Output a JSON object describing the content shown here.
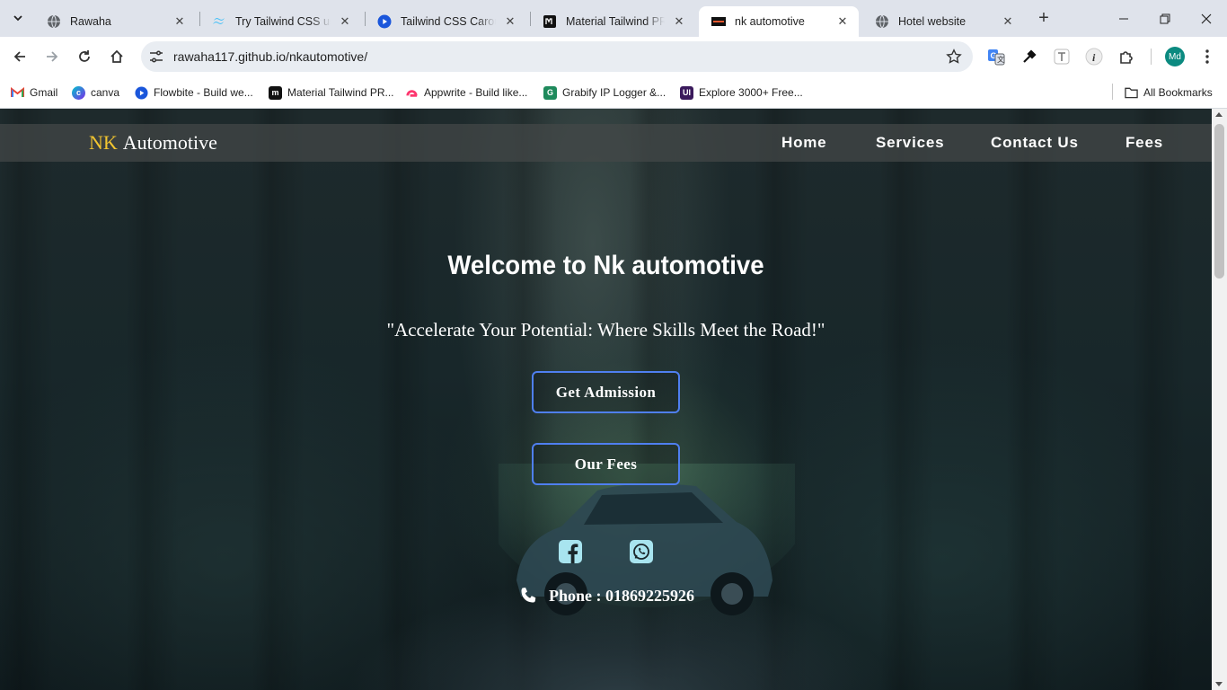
{
  "browser": {
    "tabs": [
      {
        "title": "Rawaha",
        "icon": "globe-icon",
        "active": false
      },
      {
        "title": "Try Tailwind CSS using",
        "icon": "tailwind-icon",
        "active": false
      },
      {
        "title": "Tailwind CSS Carousel",
        "icon": "play-circle-icon",
        "active": false
      },
      {
        "title": "Material Tailwind PRO",
        "icon": "material-tailwind-icon",
        "active": false
      },
      {
        "title": "nk automotive",
        "icon": "site-favicon",
        "active": true
      },
      {
        "title": "Hotel website",
        "icon": "globe-icon",
        "active": false
      }
    ],
    "url": "rawaha117.github.io/nkautomotive/",
    "profile_initials": "Md",
    "bookmarks": [
      {
        "label": "Gmail",
        "icon": "gmail-icon"
      },
      {
        "label": "canva",
        "icon": "canva-icon"
      },
      {
        "label": "Flowbite - Build we...",
        "icon": "flowbite-icon"
      },
      {
        "label": "Material Tailwind PR...",
        "icon": "material-tailwind-icon"
      },
      {
        "label": "Appwrite - Build like...",
        "icon": "appwrite-icon"
      },
      {
        "label": "Grabify IP Logger &...",
        "icon": "grabify-icon"
      },
      {
        "label": "Explore 3000+ Free...",
        "icon": "ui-icon"
      }
    ],
    "all_bookmarks_label": "All Bookmarks"
  },
  "site": {
    "logo_accent": "NK",
    "logo_text": "Automotive",
    "nav": [
      "Home",
      "Services",
      "Contact Us",
      "Fees"
    ],
    "hero_title": "Welcome to Nk automotive",
    "hero_tagline": "\"Accelerate Your Potential: Where Skills Meet the Road!\"",
    "cta_admission": "Get Admission",
    "cta_fees": "Our Fees",
    "phone_text": "Phone : 01869225926",
    "social_icons": [
      "facebook-icon",
      "whatsapp-icon"
    ]
  },
  "colors": {
    "logo_accent": "#f2c530",
    "button_border": "#4f7ff0",
    "social_icon": "#a8e4ef",
    "tab_strip": "#dfe3eb"
  }
}
